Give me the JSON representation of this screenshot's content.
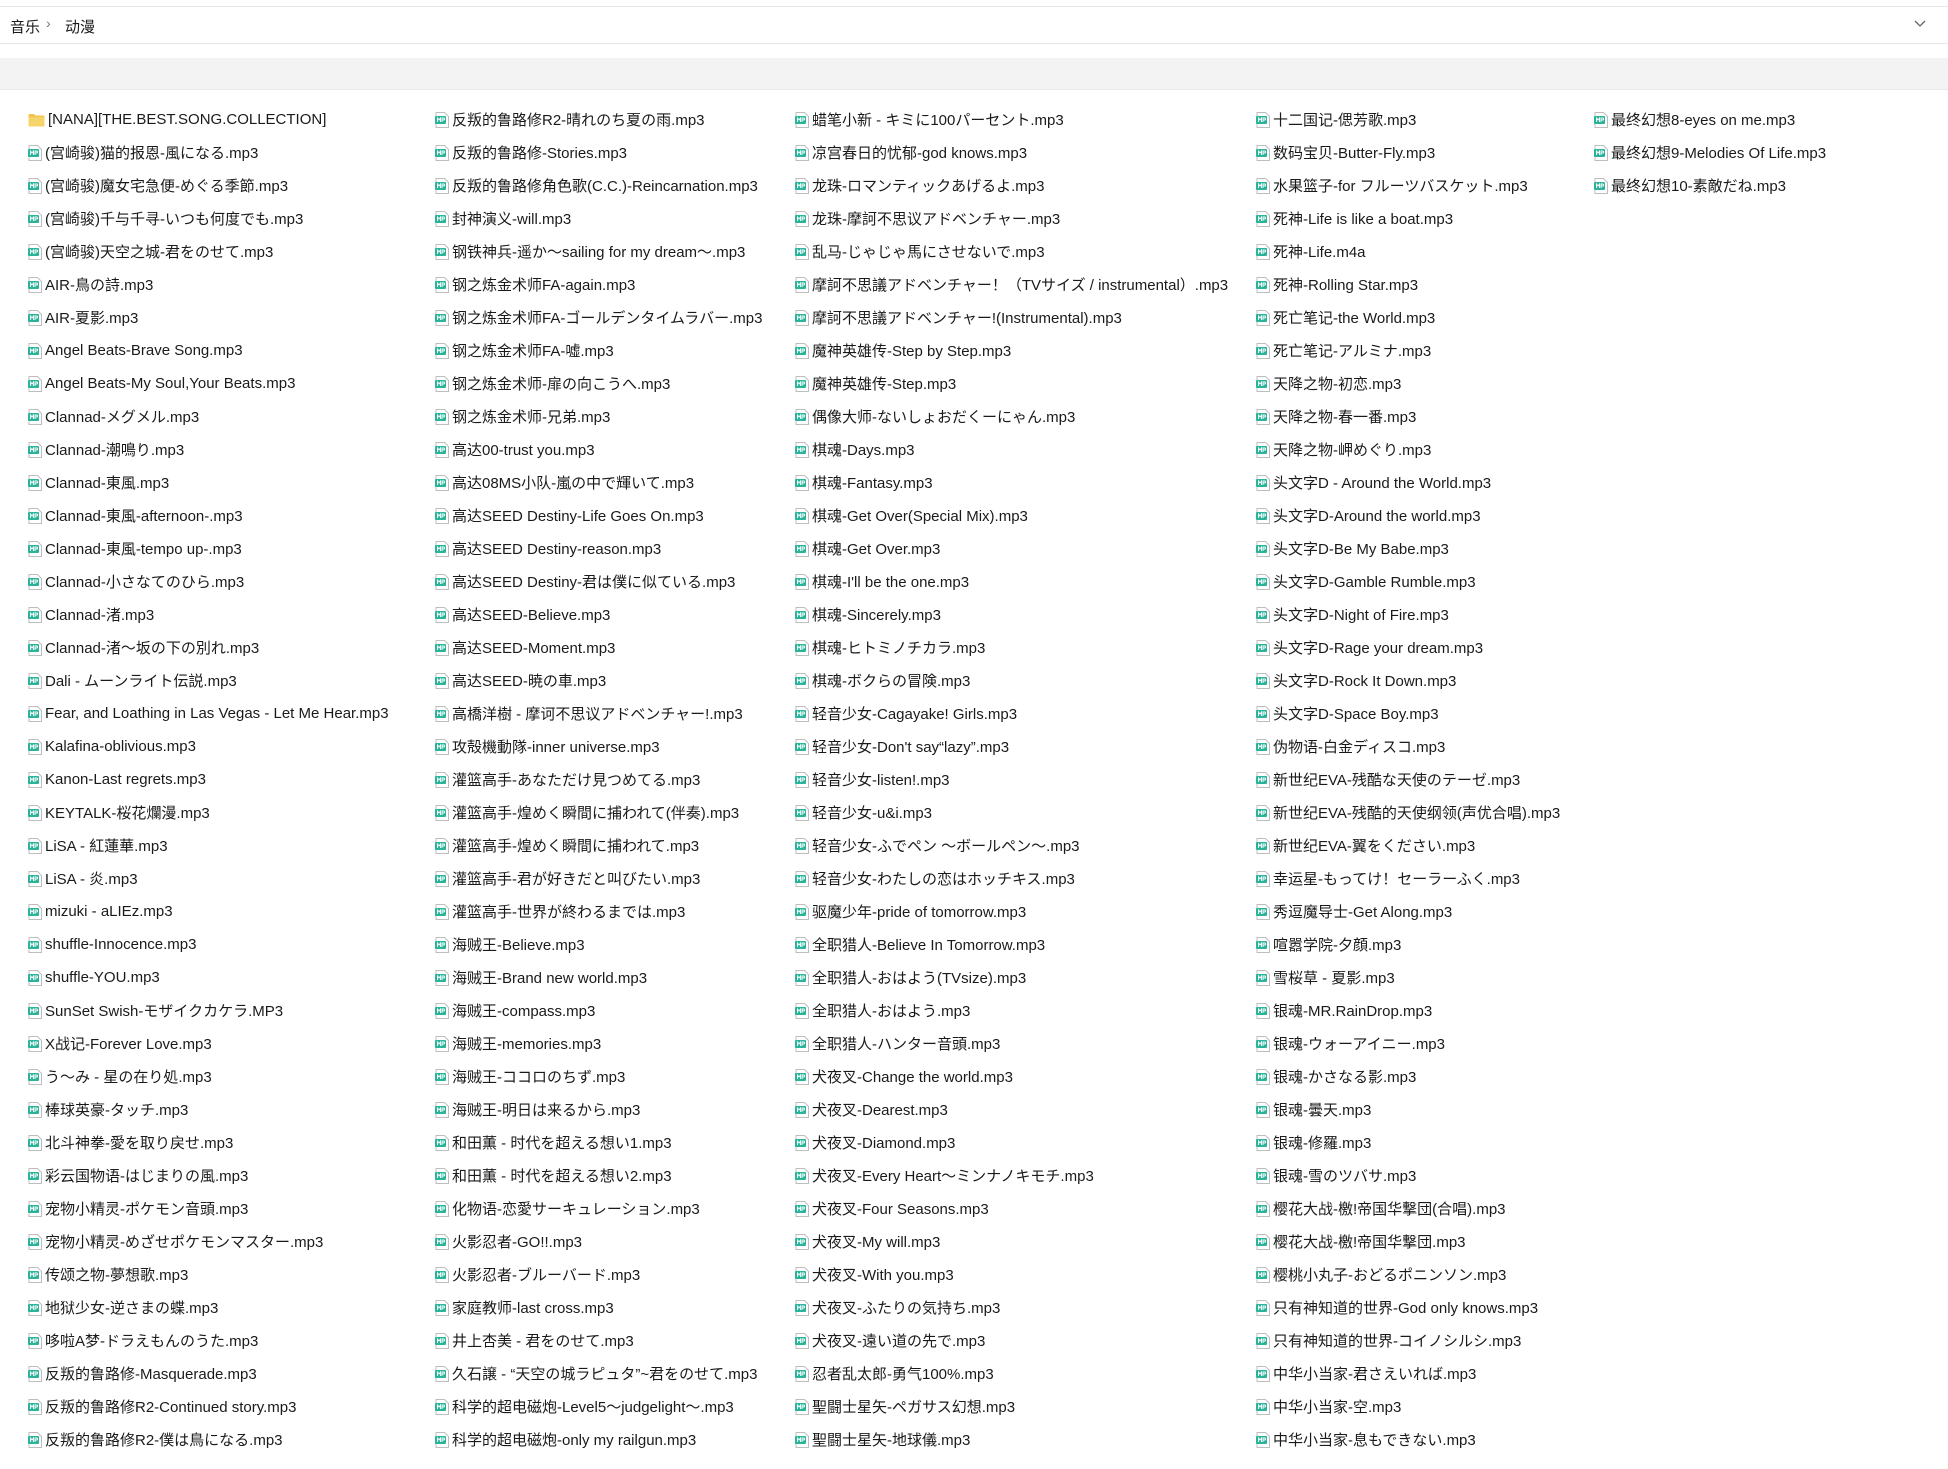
{
  "breadcrumb": {
    "root": "音乐",
    "separator": "›",
    "current": "动漫",
    "chevron_icon": "chevron-down-icon"
  },
  "colors": {
    "folder": "#f3c44b",
    "mp3_icon": "#2bb39a",
    "toolbar_bg": "#f3f3f3"
  },
  "files": {
    "columns": [
      [
        {
          "name": "[NANA][THE.BEST.SONG.COLLECTION]",
          "type": "folder"
        },
        {
          "name": "(宫崎骏)猫的报恩-風になる.mp3",
          "type": "mp3"
        },
        {
          "name": "(宫崎骏)魔女宅急便-めぐる季節.mp3",
          "type": "mp3"
        },
        {
          "name": "(宫崎骏)千与千寻-いつも何度でも.mp3",
          "type": "mp3"
        },
        {
          "name": "(宫崎骏)天空之城-君をのせて.mp3",
          "type": "mp3"
        },
        {
          "name": "AIR-鳥の詩.mp3",
          "type": "mp3"
        },
        {
          "name": "AIR-夏影.mp3",
          "type": "mp3"
        },
        {
          "name": "Angel Beats-Brave Song.mp3",
          "type": "mp3"
        },
        {
          "name": "Angel Beats-My Soul,Your Beats.mp3",
          "type": "mp3"
        },
        {
          "name": "Clannad-メグメル.mp3",
          "type": "mp3"
        },
        {
          "name": "Clannad-潮鳴り.mp3",
          "type": "mp3"
        },
        {
          "name": "Clannad-東風.mp3",
          "type": "mp3"
        },
        {
          "name": "Clannad-東風-afternoon-.mp3",
          "type": "mp3"
        },
        {
          "name": "Clannad-東風-tempo up-.mp3",
          "type": "mp3"
        },
        {
          "name": "Clannad-小さなてのひら.mp3",
          "type": "mp3"
        },
        {
          "name": "Clannad-渚.mp3",
          "type": "mp3"
        },
        {
          "name": "Clannad-渚～坂の下の別れ.mp3",
          "type": "mp3"
        },
        {
          "name": "Dali - ムーンライト伝説.mp3",
          "type": "mp3"
        },
        {
          "name": "Fear, and Loathing in Las Vegas - Let Me Hear.mp3",
          "type": "mp3"
        },
        {
          "name": "Kalafina-oblivious.mp3",
          "type": "mp3"
        },
        {
          "name": "Kanon-Last regrets.mp3",
          "type": "mp3"
        },
        {
          "name": "KEYTALK-桜花爛漫.mp3",
          "type": "mp3"
        },
        {
          "name": "LiSA - 紅蓮華.mp3",
          "type": "mp3"
        },
        {
          "name": "LiSA - 炎.mp3",
          "type": "mp3"
        },
        {
          "name": "mizuki - aLIEz.mp3",
          "type": "mp3"
        },
        {
          "name": "shuffle-Innocence.mp3",
          "type": "mp3"
        },
        {
          "name": "shuffle-YOU.mp3",
          "type": "mp3"
        },
        {
          "name": "SunSet Swish-モザイクカケラ.MP3",
          "type": "mp3"
        },
        {
          "name": "X战记-Forever Love.mp3",
          "type": "mp3"
        },
        {
          "name": "う～み - 星の在り処.mp3",
          "type": "mp3"
        },
        {
          "name": "棒球英豪-タッチ.mp3",
          "type": "mp3"
        },
        {
          "name": "北斗神拳-愛を取り戻せ.mp3",
          "type": "mp3"
        },
        {
          "name": "彩云国物语-はじまりの風.mp3",
          "type": "mp3"
        },
        {
          "name": "宠物小精灵-ポケモン音頭.mp3",
          "type": "mp3"
        },
        {
          "name": "宠物小精灵-めざせポケモンマスター.mp3",
          "type": "mp3"
        },
        {
          "name": "传颂之物-夢想歌.mp3",
          "type": "mp3"
        },
        {
          "name": "地狱少女-逆さまの蝶.mp3",
          "type": "mp3"
        },
        {
          "name": "哆啦A梦-ドラえもんのうた.mp3",
          "type": "mp3"
        },
        {
          "name": "反叛的鲁路修-Masquerade.mp3",
          "type": "mp3"
        },
        {
          "name": "反叛的鲁路修R2-Continued story.mp3",
          "type": "mp3"
        },
        {
          "name": "反叛的鲁路修R2-僕は鳥になる.mp3",
          "type": "mp3"
        }
      ],
      [
        {
          "name": "反叛的鲁路修R2-晴れのち夏の雨.mp3",
          "type": "mp3"
        },
        {
          "name": "反叛的鲁路修-Stories.mp3",
          "type": "mp3"
        },
        {
          "name": "反叛的鲁路修角色歌(C.C.)-Reincarnation.mp3",
          "type": "mp3"
        },
        {
          "name": "封神演义-will.mp3",
          "type": "mp3"
        },
        {
          "name": "钢铁神兵-遥か～sailing for my dream～.mp3",
          "type": "mp3"
        },
        {
          "name": "钢之炼金术师FA-again.mp3",
          "type": "mp3"
        },
        {
          "name": "钢之炼金术师FA-ゴールデンタイムラバー.mp3",
          "type": "mp3"
        },
        {
          "name": "钢之炼金术师FA-嘘.mp3",
          "type": "mp3"
        },
        {
          "name": "钢之炼金术师-扉の向こうへ.mp3",
          "type": "mp3"
        },
        {
          "name": "钢之炼金术师-兄弟.mp3",
          "type": "mp3"
        },
        {
          "name": "高达00-trust you.mp3",
          "type": "mp3"
        },
        {
          "name": "高达08MS小队-嵐の中で輝いて.mp3",
          "type": "mp3"
        },
        {
          "name": "高达SEED Destiny-Life Goes On.mp3",
          "type": "mp3"
        },
        {
          "name": "高达SEED Destiny-reason.mp3",
          "type": "mp3"
        },
        {
          "name": "高达SEED Destiny-君は僕に似ている.mp3",
          "type": "mp3"
        },
        {
          "name": "高达SEED-Believe.mp3",
          "type": "mp3"
        },
        {
          "name": "高达SEED-Moment.mp3",
          "type": "mp3"
        },
        {
          "name": "高达SEED-暁の車.mp3",
          "type": "mp3"
        },
        {
          "name": "高橋洋樹 - 摩诃不思议アドベンチャー!.mp3",
          "type": "mp3"
        },
        {
          "name": "攻殻機動隊-inner universe.mp3",
          "type": "mp3"
        },
        {
          "name": "灌篮高手-あなただけ見つめてる.mp3",
          "type": "mp3"
        },
        {
          "name": "灌篮高手-煌めく瞬間に捕われて(伴奏).mp3",
          "type": "mp3"
        },
        {
          "name": "灌篮高手-煌めく瞬間に捕われて.mp3",
          "type": "mp3"
        },
        {
          "name": "灌篮高手-君が好きだと叫びたい.mp3",
          "type": "mp3"
        },
        {
          "name": "灌篮高手-世界が終わるまでは.mp3",
          "type": "mp3"
        },
        {
          "name": "海贼王-Believe.mp3",
          "type": "mp3"
        },
        {
          "name": "海贼王-Brand new world.mp3",
          "type": "mp3"
        },
        {
          "name": "海贼王-compass.mp3",
          "type": "mp3"
        },
        {
          "name": "海贼王-memories.mp3",
          "type": "mp3"
        },
        {
          "name": "海贼王-ココロのちず.mp3",
          "type": "mp3"
        },
        {
          "name": "海贼王-明日は来るから.mp3",
          "type": "mp3"
        },
        {
          "name": "和田薫 - 时代を超える想い1.mp3",
          "type": "mp3"
        },
        {
          "name": "和田薫 - 时代を超える想い2.mp3",
          "type": "mp3"
        },
        {
          "name": "化物语-恋愛サーキュレーション.mp3",
          "type": "mp3"
        },
        {
          "name": "火影忍者-GO!!.mp3",
          "type": "mp3"
        },
        {
          "name": "火影忍者-ブルーバード.mp3",
          "type": "mp3"
        },
        {
          "name": "家庭教师-last cross.mp3",
          "type": "mp3"
        },
        {
          "name": "井上杏美 - 君をのせて.mp3",
          "type": "mp3"
        },
        {
          "name": "久石譲 - “天空の城ラピュタ”~君をのせて.mp3",
          "type": "mp3"
        },
        {
          "name": "科学的超电磁炮-Level5～judgelight～.mp3",
          "type": "mp3"
        },
        {
          "name": "科学的超电磁炮-only my railgun.mp3",
          "type": "mp3"
        }
      ],
      [
        {
          "name": "蜡笔小新 - キミに100パーセント.mp3",
          "type": "mp3"
        },
        {
          "name": "凉宫春日的忧郁-god knows.mp3",
          "type": "mp3"
        },
        {
          "name": "龙珠-ロマンティックあげるよ.mp3",
          "type": "mp3"
        },
        {
          "name": "龙珠-摩訶不思议アドベンチャー.mp3",
          "type": "mp3"
        },
        {
          "name": "乱马-じゃじゃ馬にさせないで.mp3",
          "type": "mp3"
        },
        {
          "name": "摩訶不思議アドベンチャー！（TVサイズ / instrumental）.mp3",
          "type": "mp3"
        },
        {
          "name": "摩訶不思議アドベンチャー!(Instrumental).mp3",
          "type": "mp3"
        },
        {
          "name": "魔神英雄传-Step by Step.mp3",
          "type": "mp3"
        },
        {
          "name": "魔神英雄传-Step.mp3",
          "type": "mp3"
        },
        {
          "name": "偶像大师-ないしょおだくーにゃん.mp3",
          "type": "mp3"
        },
        {
          "name": "棋魂-Days.mp3",
          "type": "mp3"
        },
        {
          "name": "棋魂-Fantasy.mp3",
          "type": "mp3"
        },
        {
          "name": "棋魂-Get Over(Special Mix).mp3",
          "type": "mp3"
        },
        {
          "name": "棋魂-Get Over.mp3",
          "type": "mp3"
        },
        {
          "name": "棋魂-I'll be the one.mp3",
          "type": "mp3"
        },
        {
          "name": "棋魂-Sincerely.mp3",
          "type": "mp3"
        },
        {
          "name": "棋魂-ヒトミノチカラ.mp3",
          "type": "mp3"
        },
        {
          "name": "棋魂-ボクらの冒険.mp3",
          "type": "mp3"
        },
        {
          "name": "轻音少女-Cagayake!  Girls.mp3",
          "type": "mp3"
        },
        {
          "name": "轻音少女-Don't say“lazy”.mp3",
          "type": "mp3"
        },
        {
          "name": "轻音少女-listen!.mp3",
          "type": "mp3"
        },
        {
          "name": "轻音少女-u&i.mp3",
          "type": "mp3"
        },
        {
          "name": "轻音少女-ふでペン ～ボールペン～.mp3",
          "type": "mp3"
        },
        {
          "name": "轻音少女-わたしの恋はホッチキス.mp3",
          "type": "mp3"
        },
        {
          "name": "驱魔少年-pride of tomorrow.mp3",
          "type": "mp3"
        },
        {
          "name": "全职猎人-Believe In Tomorrow.mp3",
          "type": "mp3"
        },
        {
          "name": "全职猎人-おはよう(TVsize).mp3",
          "type": "mp3"
        },
        {
          "name": "全职猎人-おはよう.mp3",
          "type": "mp3"
        },
        {
          "name": "全职猎人-ハンター音頭.mp3",
          "type": "mp3"
        },
        {
          "name": "犬夜叉-Change the world.mp3",
          "type": "mp3"
        },
        {
          "name": "犬夜叉-Dearest.mp3",
          "type": "mp3"
        },
        {
          "name": "犬夜叉-Diamond.mp3",
          "type": "mp3"
        },
        {
          "name": "犬夜叉-Every Heart～ミンナノキモチ.mp3",
          "type": "mp3"
        },
        {
          "name": "犬夜叉-Four Seasons.mp3",
          "type": "mp3"
        },
        {
          "name": "犬夜叉-My will.mp3",
          "type": "mp3"
        },
        {
          "name": "犬夜叉-With you.mp3",
          "type": "mp3"
        },
        {
          "name": "犬夜叉-ふたりの気持ち.mp3",
          "type": "mp3"
        },
        {
          "name": "犬夜叉-遠い道の先で.mp3",
          "type": "mp3"
        },
        {
          "name": "忍者乱太郎-勇气100%.mp3",
          "type": "mp3"
        },
        {
          "name": "聖闘士星矢-ペガサス幻想.mp3",
          "type": "mp3"
        },
        {
          "name": "聖闘士星矢-地球儀.mp3",
          "type": "mp3"
        }
      ],
      [
        {
          "name": "十二国记-偲芳歌.mp3",
          "type": "mp3"
        },
        {
          "name": "数码宝贝-Butter-Fly.mp3",
          "type": "mp3"
        },
        {
          "name": "水果篮子-for フルーツバスケット.mp3",
          "type": "mp3"
        },
        {
          "name": "死神-Life is like a boat.mp3",
          "type": "mp3"
        },
        {
          "name": "死神-Life.m4a",
          "type": "mp3"
        },
        {
          "name": "死神-Rolling Star.mp3",
          "type": "mp3"
        },
        {
          "name": "死亡笔记-the World.mp3",
          "type": "mp3"
        },
        {
          "name": "死亡笔记-アルミナ.mp3",
          "type": "mp3"
        },
        {
          "name": "天降之物-初恋.mp3",
          "type": "mp3"
        },
        {
          "name": "天降之物-春一番.mp3",
          "type": "mp3"
        },
        {
          "name": "天降之物-岬めぐり.mp3",
          "type": "mp3"
        },
        {
          "name": "头文字D - Around the World.mp3",
          "type": "mp3"
        },
        {
          "name": "头文字D-Around the world.mp3",
          "type": "mp3"
        },
        {
          "name": "头文字D-Be My Babe.mp3",
          "type": "mp3"
        },
        {
          "name": "头文字D-Gamble Rumble.mp3",
          "type": "mp3"
        },
        {
          "name": "头文字D-Night of Fire.mp3",
          "type": "mp3"
        },
        {
          "name": "头文字D-Rage your dream.mp3",
          "type": "mp3"
        },
        {
          "name": "头文字D-Rock It Down.mp3",
          "type": "mp3"
        },
        {
          "name": "头文字D-Space Boy.mp3",
          "type": "mp3"
        },
        {
          "name": "伪物语-白金ディスコ.mp3",
          "type": "mp3"
        },
        {
          "name": "新世纪EVA-残酷な天使のテーゼ.mp3",
          "type": "mp3"
        },
        {
          "name": "新世纪EVA-残酷的天使纲领(声优合唱).mp3",
          "type": "mp3"
        },
        {
          "name": "新世纪EVA-翼をください.mp3",
          "type": "mp3"
        },
        {
          "name": "幸运星-もってけ！セーラーふく.mp3",
          "type": "mp3"
        },
        {
          "name": "秀逗魔导士-Get Along.mp3",
          "type": "mp3"
        },
        {
          "name": "喧嚣学院-夕顔.mp3",
          "type": "mp3"
        },
        {
          "name": "雪桜草 - 夏影.mp3",
          "type": "mp3"
        },
        {
          "name": "银魂-MR.RainDrop.mp3",
          "type": "mp3"
        },
        {
          "name": "银魂-ウォーアイニー.mp3",
          "type": "mp3"
        },
        {
          "name": "银魂-かさなる影.mp3",
          "type": "mp3"
        },
        {
          "name": "银魂-曇天.mp3",
          "type": "mp3"
        },
        {
          "name": "银魂-修羅.mp3",
          "type": "mp3"
        },
        {
          "name": "银魂-雪のツバサ.mp3",
          "type": "mp3"
        },
        {
          "name": "樱花大战-檄!帝国华撃団(合唱).mp3",
          "type": "mp3"
        },
        {
          "name": "樱花大战-檄!帝国华撃団.mp3",
          "type": "mp3"
        },
        {
          "name": "樱桃小丸子-おどるポニンソン.mp3",
          "type": "mp3"
        },
        {
          "name": "只有神知道的世界-God only knows.mp3",
          "type": "mp3"
        },
        {
          "name": "只有神知道的世界-コイノシルシ.mp3",
          "type": "mp3"
        },
        {
          "name": "中华小当家-君さえいれば.mp3",
          "type": "mp3"
        },
        {
          "name": "中华小当家-空.mp3",
          "type": "mp3"
        },
        {
          "name": "中华小当家-息もできない.mp3",
          "type": "mp3"
        }
      ],
      [
        {
          "name": "最终幻想8-eyes on me.mp3",
          "type": "mp3"
        },
        {
          "name": "最终幻想9-Melodies Of Life.mp3",
          "type": "mp3"
        },
        {
          "name": "最终幻想10-素敵だね.mp3",
          "type": "mp3"
        }
      ]
    ]
  }
}
